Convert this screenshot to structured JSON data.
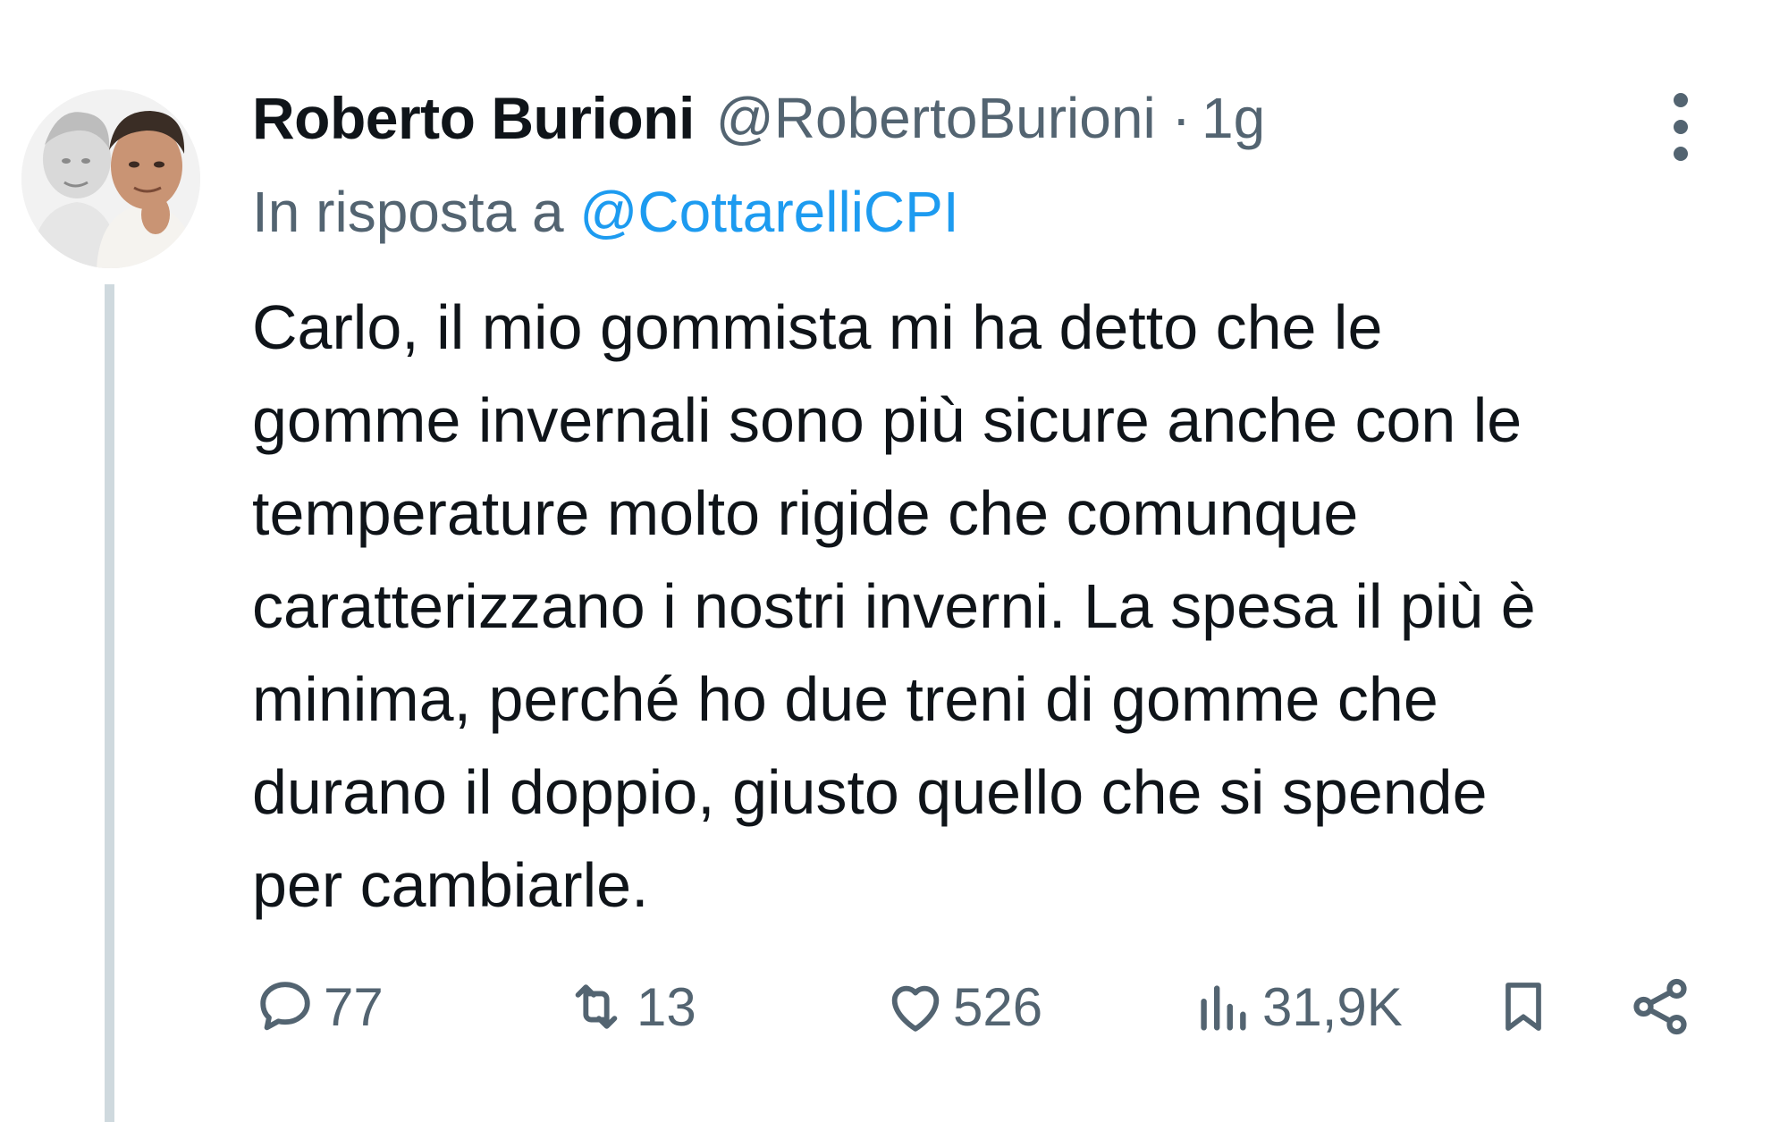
{
  "tweet": {
    "author_name": "Roberto Burioni",
    "author_handle": "@RobertoBurioni",
    "separator": "·",
    "time": "1g",
    "reply_prefix": "In risposta a",
    "reply_handle": "@CottarelliCPI",
    "text": "Carlo, il mio gommista mi ha detto che le\ngomme invernali sono più sicure anche con le\ntemperature molto rigide che comunque\ncaratterizzano i nostri inverni. La spesa il più è\nminima, perché ho due treni di gomme che\ndurano il doppio, giusto quello che si spende\nper cambiarle."
  },
  "actions": {
    "replies": "77",
    "retweets": "13",
    "likes": "526",
    "views": "31,9K"
  },
  "icons": {
    "reply": "speech-bubble-icon",
    "retweet": "retweet-icon",
    "like": "heart-icon",
    "views": "bar-chart-icon",
    "bookmark": "bookmark-icon",
    "share": "share-icon",
    "more": "vertical-ellipsis-icon"
  },
  "colors": {
    "text": "#0f1419",
    "secondary": "#536471",
    "link": "#1d9bf0",
    "thread_line": "#cfd9de"
  }
}
